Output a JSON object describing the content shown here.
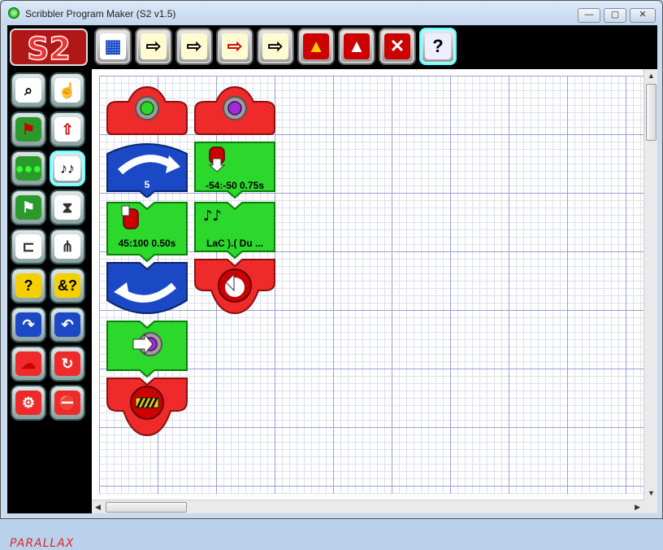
{
  "window": {
    "title": "Scribbler Program Maker (S2 v1.5)",
    "min_label": "—",
    "max_label": "▢",
    "close_label": "✕"
  },
  "logo": {
    "text": "S2"
  },
  "toolbar": {
    "buttons": [
      {
        "name": "grid-view-icon",
        "glyph": "▦"
      },
      {
        "name": "open-file-icon",
        "glyph": "⇨"
      },
      {
        "name": "import-file-icon",
        "glyph": "⇨"
      },
      {
        "name": "save-file-icon",
        "glyph": "⇨"
      },
      {
        "name": "export-list-icon",
        "glyph": "⇨"
      },
      {
        "name": "robot-halo-icon",
        "glyph": "▲"
      },
      {
        "name": "robot-compass-icon",
        "glyph": "▲"
      },
      {
        "name": "robot-tools-icon",
        "glyph": "✕"
      },
      {
        "name": "help-icon",
        "glyph": "?"
      }
    ]
  },
  "palette": {
    "items": [
      {
        "name": "zoom-icon",
        "glyph": "⌕"
      },
      {
        "name": "hand-icon",
        "glyph": "☝"
      },
      {
        "name": "flag-square-icon",
        "glyph": "⚑"
      },
      {
        "name": "motor-up-icon",
        "glyph": "⇧"
      },
      {
        "name": "lights-icon",
        "glyph": "●●●"
      },
      {
        "name": "music-notes-icon",
        "glyph": "♪♪"
      },
      {
        "name": "flag-arrow-icon",
        "glyph": "⚑"
      },
      {
        "name": "hourglass-icon",
        "glyph": "⧗"
      },
      {
        "name": "branch-icon",
        "glyph": "⊏"
      },
      {
        "name": "fork-icon",
        "glyph": "⋔"
      },
      {
        "name": "question-icon",
        "glyph": "?"
      },
      {
        "name": "and-question-icon",
        "glyph": "&?"
      },
      {
        "name": "loop-top-icon",
        "glyph": "↷"
      },
      {
        "name": "loop-bottom-icon",
        "glyph": "↶"
      },
      {
        "name": "cloud-icon",
        "glyph": "☁"
      },
      {
        "name": "return-icon",
        "glyph": "↻"
      },
      {
        "name": "gear-arrow-icon",
        "glyph": "⚙"
      },
      {
        "name": "stop-icon",
        "glyph": "⛔"
      }
    ],
    "brand": "PARALLAX"
  },
  "program": {
    "loop_count": "5",
    "move_label": "45:100 0.50s",
    "move2_label": "-54:-50 0.75s",
    "music_label": "LaC ).( Du ..."
  }
}
